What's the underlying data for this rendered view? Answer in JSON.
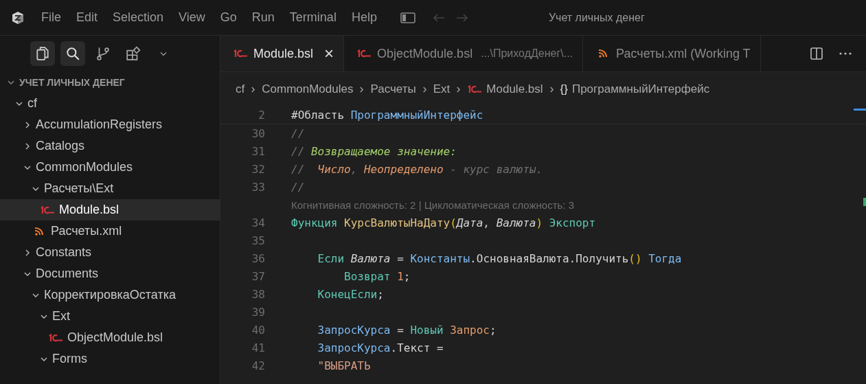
{
  "window": {
    "title": "Учет личных денег"
  },
  "menu": [
    "File",
    "Edit",
    "Selection",
    "View",
    "Go",
    "Run",
    "Terminal",
    "Help"
  ],
  "activity": [
    {
      "kind": "explorer",
      "selected": true
    },
    {
      "kind": "search",
      "selected": true
    },
    {
      "kind": "source-control",
      "selected": false
    },
    {
      "kind": "extensions",
      "selected": false
    },
    {
      "kind": "more",
      "selected": false
    }
  ],
  "navigation": {
    "back_disabled": true,
    "forward_disabled": true
  },
  "explorer": {
    "title": "УЧЕТ ЛИЧНЫХ ДЕНЕГ",
    "expanded": true,
    "items": [
      {
        "label": "cf",
        "kind": "folder",
        "expanded": true,
        "selected": false,
        "children": [
          {
            "label": "AccumulationRegisters",
            "kind": "folder",
            "expanded": false,
            "selected": false
          },
          {
            "label": "Catalogs",
            "kind": "folder",
            "expanded": false,
            "selected": false
          },
          {
            "label": "CommonModules",
            "kind": "folder",
            "expanded": true,
            "selected": false,
            "children": [
              {
                "label": "Расчеты\\Ext",
                "kind": "folder",
                "expanded": true,
                "selected": false,
                "children": [
                  {
                    "label": "Module.bsl",
                    "kind": "bsl",
                    "selected": true
                  }
                ]
              },
              {
                "label": "Расчеты.xml",
                "kind": "xml",
                "selected": false
              }
            ]
          },
          {
            "label": "Constants",
            "kind": "folder",
            "expanded": false,
            "selected": false
          },
          {
            "label": "Documents",
            "kind": "folder",
            "expanded": true,
            "selected": false,
            "children": [
              {
                "label": "КорректировкаОстатка",
                "kind": "folder",
                "expanded": true,
                "selected": false,
                "children": [
                  {
                    "label": "Ext",
                    "kind": "folder",
                    "expanded": true,
                    "selected": false,
                    "children": [
                      {
                        "label": "ObjectModule.bsl",
                        "kind": "bsl",
                        "selected": false
                      }
                    ]
                  },
                  {
                    "label": "Forms",
                    "kind": "folder",
                    "expanded": true,
                    "selected": false
                  }
                ]
              }
            ]
          }
        ]
      }
    ]
  },
  "tabs": [
    {
      "label": "Module.bsl",
      "kind": "bsl",
      "selected": true,
      "close": "×"
    },
    {
      "label": "ObjectModule.bsl",
      "kind": "bsl",
      "selected": false,
      "description": "...\\ПриходДенег\\..."
    },
    {
      "label": "Расчеты.xml (Working T",
      "kind": "xml",
      "selected": false
    }
  ],
  "breadcrumb": [
    {
      "label": "cf",
      "kind": "folder"
    },
    {
      "label": "CommonModules",
      "kind": "folder"
    },
    {
      "label": "Расчеты",
      "kind": "folder"
    },
    {
      "label": "Ext",
      "kind": "folder"
    },
    {
      "label": "Module.bsl",
      "kind": "bsl"
    },
    {
      "label": "ПрограммныйИнтерфейс",
      "kind": "symbol",
      "icon": "{}"
    }
  ],
  "code": [
    {
      "kind": "sticky",
      "number": "2",
      "tokens": [
        {
          "text": "#Область ",
          "kind": "plain"
        },
        {
          "text": "ПрограммныйИнтерфейс",
          "kind": "var"
        }
      ]
    },
    {
      "kind": "line",
      "number": "30",
      "tokens": [
        {
          "text": "//",
          "kind": "comment"
        }
      ]
    },
    {
      "kind": "line",
      "number": "31",
      "tokens": [
        {
          "text": "// ",
          "kind": "comment"
        },
        {
          "text": "Возвращаемое значение:",
          "kind": "doc"
        }
      ]
    },
    {
      "kind": "line",
      "number": "32",
      "tokens": [
        {
          "text": "//  ",
          "kind": "comment"
        },
        {
          "text": "Число",
          "kind": "doctype"
        },
        {
          "text": ", ",
          "kind": "comment"
        },
        {
          "text": "Неопределено",
          "kind": "doctype"
        },
        {
          "text": " - курс валюты.",
          "kind": "comment"
        }
      ]
    },
    {
      "kind": "line",
      "number": "33",
      "tokens": [
        {
          "text": "//",
          "kind": "comment"
        }
      ]
    },
    {
      "kind": "lens",
      "text": "Когнитивная сложность: 2 | Цикломатическая сложность: 3"
    },
    {
      "kind": "line",
      "number": "34",
      "tokens": [
        {
          "text": "Функция ",
          "kind": "keyword"
        },
        {
          "text": "КурсВалютыНаДату",
          "kind": "func"
        },
        {
          "text": "(",
          "kind": "paren"
        },
        {
          "text": "Дата",
          "kind": "param"
        },
        {
          "text": ", ",
          "kind": "plain"
        },
        {
          "text": "Валюта",
          "kind": "param"
        },
        {
          "text": ")",
          "kind": "paren"
        },
        {
          "text": " Экспорт",
          "kind": "keyword"
        }
      ]
    },
    {
      "kind": "line",
      "number": "35"
    },
    {
      "kind": "line",
      "number": "36",
      "tokens": [
        {
          "text": "    Если ",
          "kind": "keyword"
        },
        {
          "text": "Валюта",
          "kind": "param"
        },
        {
          "text": " = ",
          "kind": "plain"
        },
        {
          "text": "Константы",
          "kind": "var"
        },
        {
          "text": ".ОсновнаяВалюта.Получить",
          "kind": "plain"
        },
        {
          "text": "()",
          "kind": "paren"
        },
        {
          "text": " Тогда",
          "kind": "var"
        }
      ]
    },
    {
      "kind": "line",
      "number": "37",
      "tokens": [
        {
          "text": "        Возврат ",
          "kind": "keyword"
        },
        {
          "text": "1",
          "kind": "number"
        },
        {
          "text": ";",
          "kind": "plain"
        }
      ]
    },
    {
      "kind": "line",
      "number": "38",
      "tokens": [
        {
          "text": "    КонецЕсли",
          "kind": "keyword"
        },
        {
          "text": ";",
          "kind": "plain"
        }
      ]
    },
    {
      "kind": "line",
      "number": "39"
    },
    {
      "kind": "line",
      "number": "40",
      "tokens": [
        {
          "text": "    ЗапросКурса",
          "kind": "var"
        },
        {
          "text": " = ",
          "kind": "plain"
        },
        {
          "text": "Новый ",
          "kind": "keyword"
        },
        {
          "text": "Запрос",
          "kind": "number"
        },
        {
          "text": ";",
          "kind": "plain"
        }
      ]
    },
    {
      "kind": "line",
      "number": "41",
      "tokens": [
        {
          "text": "    ЗапросКурса",
          "kind": "var"
        },
        {
          "text": ".Текст =",
          "kind": "plain"
        }
      ]
    },
    {
      "kind": "line",
      "number": "42",
      "tokens": [
        {
          "text": "    \"ВЫБРАТЬ",
          "kind": "string"
        }
      ]
    }
  ]
}
